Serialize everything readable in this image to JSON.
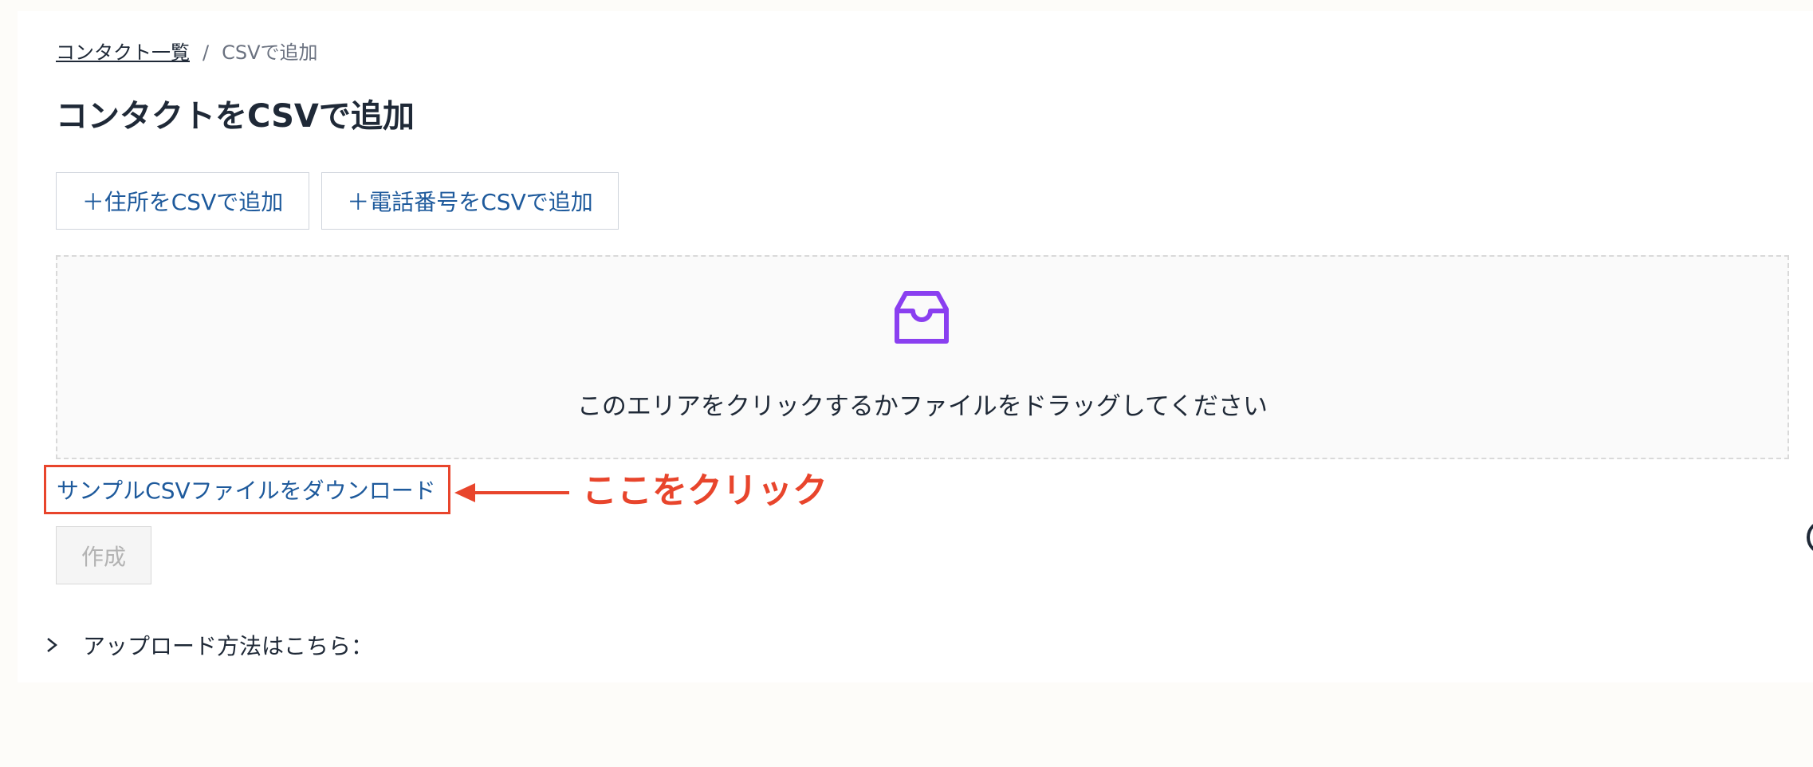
{
  "breadcrumb": {
    "parent": "コンタクト一覧",
    "separator": "/",
    "current": "CSVで追加"
  },
  "page": {
    "title": "コンタクトをCSVで追加"
  },
  "actions": {
    "add_address_csv": "＋住所をCSVで追加",
    "add_phone_csv": "＋電話番号をCSVで追加"
  },
  "dropzone": {
    "icon": "inbox-icon",
    "text": "このエリアをクリックするかファイルをドラッグしてください"
  },
  "sample": {
    "link_label": "サンプルCSVファイルをダウンロード"
  },
  "annotation": {
    "text": "ここをクリック",
    "color": "#e8452c"
  },
  "form": {
    "create_label": "作成"
  },
  "help": {
    "label": "アップロード方法はこちら："
  },
  "colors": {
    "link": "#1e5a9c",
    "accent_icon": "#8a3ff0",
    "annotation": "#e8452c"
  }
}
